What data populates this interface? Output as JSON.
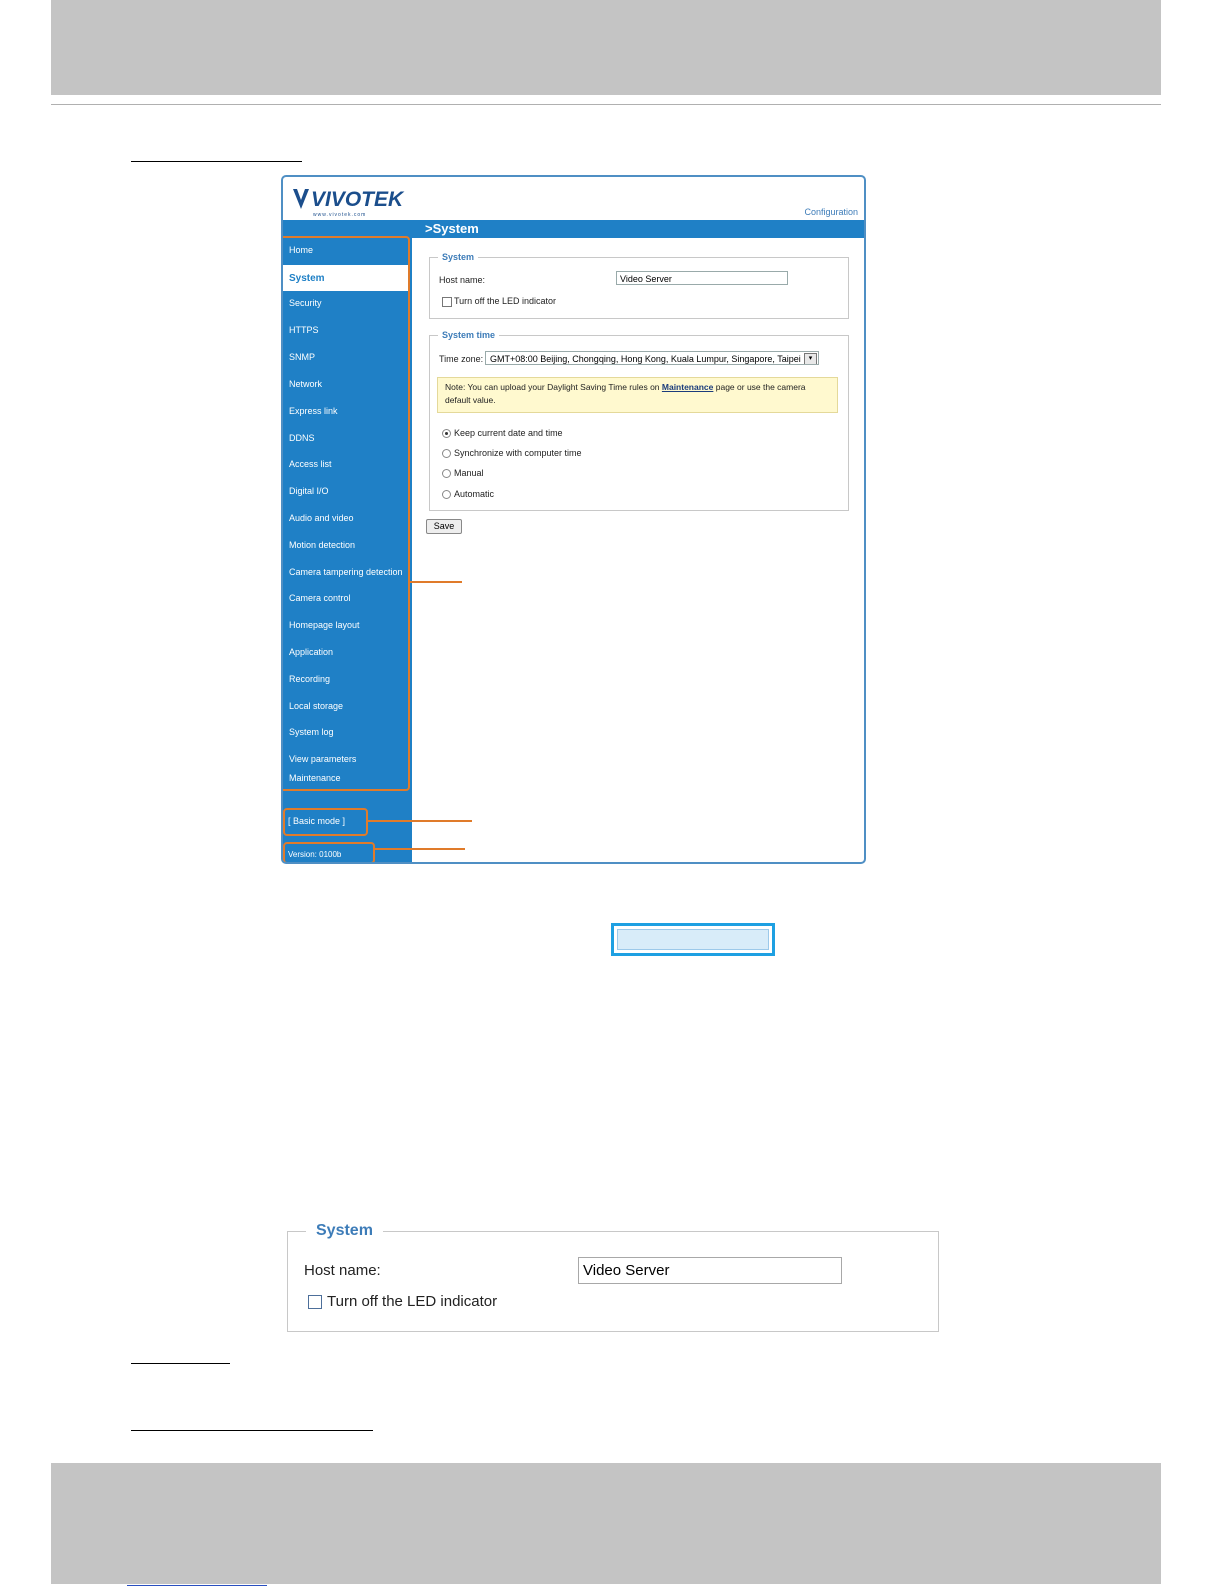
{
  "screenshot": {
    "logo_text": "VIVOTEK",
    "logo_sub": "www.vivotek.com",
    "config_link": "Configuration",
    "page_title": ">System",
    "nav": [
      "Home",
      "System",
      "Security",
      "HTTPS",
      "SNMP",
      "Network",
      "Express link",
      "DDNS",
      "Access list",
      "Digital I/O",
      "Audio and video",
      "Motion detection",
      "Camera tampering detection",
      "Camera control",
      "Homepage layout",
      "Application",
      "Recording",
      "Local storage",
      "System log",
      "View parameters",
      "Maintenance"
    ],
    "nav_active": "System",
    "basic_mode": "[ Basic mode ]",
    "version": "Version: 0100b",
    "system_legend": "System",
    "host_label": "Host name:",
    "host_value": "Video Server",
    "led_label": "Turn off the LED indicator",
    "time_legend": "System time",
    "tz_label": "Time zone:",
    "tz_value": "GMT+08:00 Beijing, Chongqing, Hong Kong, Kuala Lumpur, Singapore, Taipei",
    "note_prefix": "Note: You can upload your Daylight Saving Time rules on ",
    "note_link": "Maintenance",
    "note_suffix": " page or use the camera default value.",
    "radios": [
      "Keep current date and time",
      "Synchronize with computer time",
      "Manual",
      "Automatic"
    ],
    "radio_selected": 0,
    "save_label": "Save"
  },
  "enlarged": {
    "legend": "System",
    "host_label": "Host name:",
    "host_value": "Video Server",
    "led_label": "Turn off the LED indicator"
  }
}
